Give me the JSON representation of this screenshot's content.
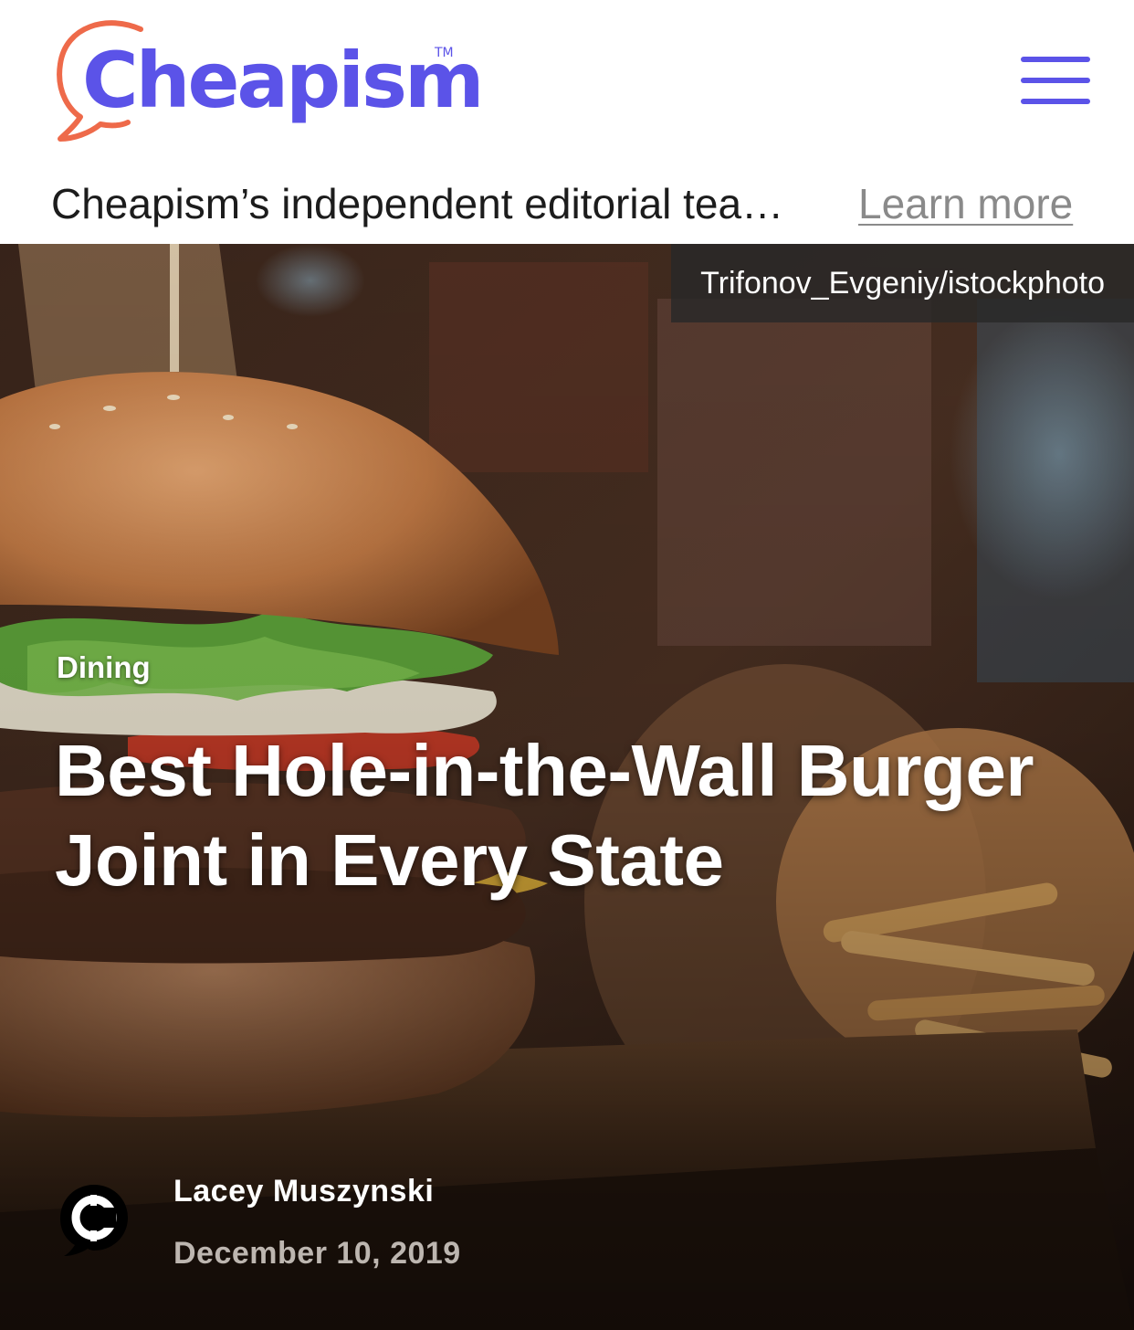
{
  "header": {
    "brand_name": "Cheapism",
    "trademark": "TM",
    "menu_icon": "hamburger-menu-icon",
    "brand_color": "#5b53e8",
    "accent_color": "#ee6a4a"
  },
  "disclosure": {
    "text": "Cheapism’s independent editorial tea…",
    "link_label": "Learn more"
  },
  "article": {
    "photo_credit": "Trifonov_Evgeniy/istockphoto",
    "category": "Dining",
    "title": "Best Hole-in-the-Wall Burger Joint in Every State",
    "author": "Lacey Muszynski",
    "date": "December 10, 2019",
    "author_avatar_icon": "cheapism-coin-icon"
  }
}
